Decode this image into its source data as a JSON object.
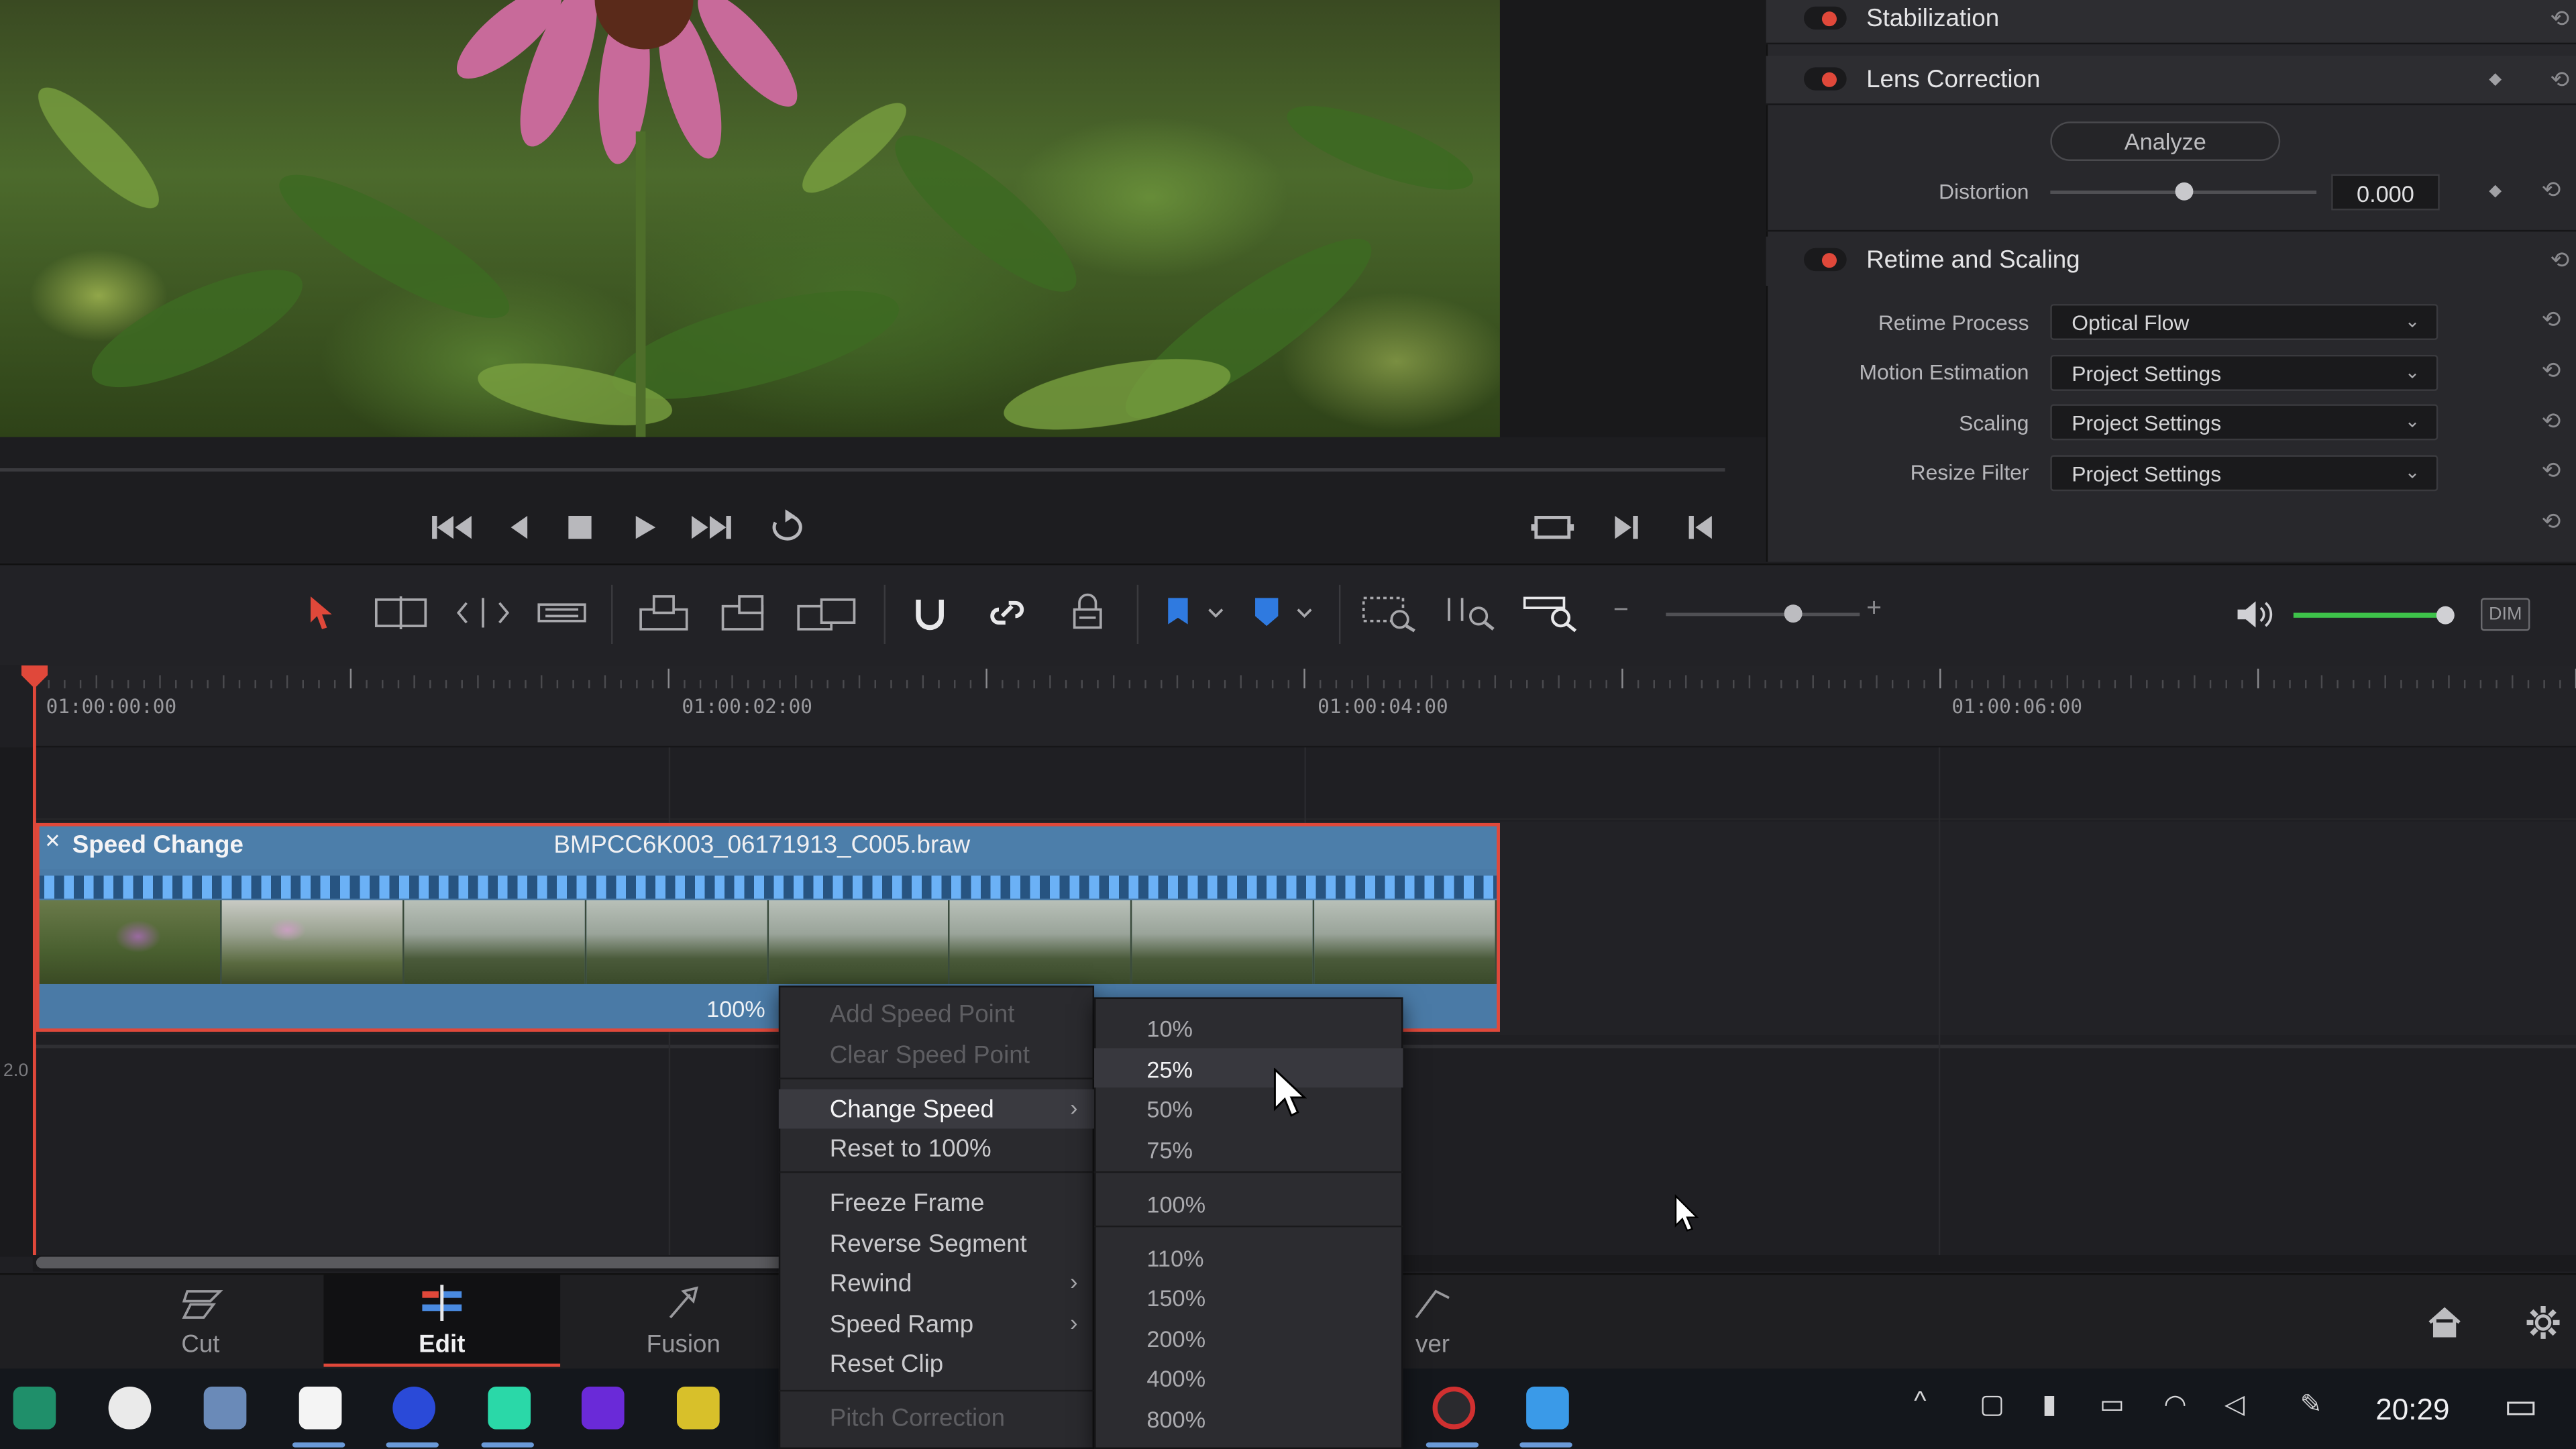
{
  "inspector": {
    "sections": {
      "stabilization": "Stabilization",
      "lens_correction": "Lens Correction",
      "retime_scaling": "Retime and Scaling"
    },
    "analyze_label": "Analyze",
    "distortion_label": "Distortion",
    "distortion_value": "0.000",
    "distortion_level": 0.5,
    "retime_process_label": "Retime Process",
    "retime_process_value": "Optical Flow",
    "motion_estimation_label": "Motion Estimation",
    "motion_estimation_value": "Project Settings",
    "scaling_label": "Scaling",
    "scaling_value": "Project Settings",
    "resize_filter_label": "Resize Filter",
    "resize_filter_value": "Project Settings"
  },
  "timeline": {
    "timecodes": [
      "01:00:00:00",
      "01:00:02:00",
      "01:00:04:00",
      "01:00:06:00"
    ],
    "track_label_partial": "2.0",
    "clip": {
      "title": "Speed Change",
      "filename": "BMPCC6K003_06171913_C005.braw",
      "speed": "100%"
    },
    "zoom_level": 0.65,
    "volume_level": 1.0,
    "dim_label": "DIM"
  },
  "context_menu": {
    "items": [
      {
        "label": "Add Speed Point",
        "state": "disabled"
      },
      {
        "label": "Clear Speed Point",
        "state": "disabled"
      },
      {
        "label": "Change Speed",
        "state": "active"
      },
      {
        "label": "Reset to 100%",
        "state": "normal"
      },
      {
        "label": "Freeze Frame",
        "state": "normal"
      },
      {
        "label": "Reverse Segment",
        "state": "normal"
      },
      {
        "label": "Rewind",
        "state": "normal"
      },
      {
        "label": "Speed Ramp",
        "state": "normal"
      },
      {
        "label": "Reset Clip",
        "state": "normal"
      },
      {
        "label": "Pitch Correction",
        "state": "disabled"
      }
    ]
  },
  "submenu": {
    "items": [
      "10%",
      "25%",
      "50%",
      "75%",
      "100%",
      "110%",
      "150%",
      "200%",
      "400%",
      "800%"
    ],
    "hovered": "25%"
  },
  "pages": {
    "cut": "Cut",
    "edit": "Edit",
    "fusion": "Fusion",
    "deliver_partial": "ver"
  },
  "taskbar": {
    "clock": "20:29"
  },
  "colors": {
    "accent_red": "#e0483a",
    "clip_blue": "#4a7aa6",
    "volume_green": "#3ec34a"
  }
}
